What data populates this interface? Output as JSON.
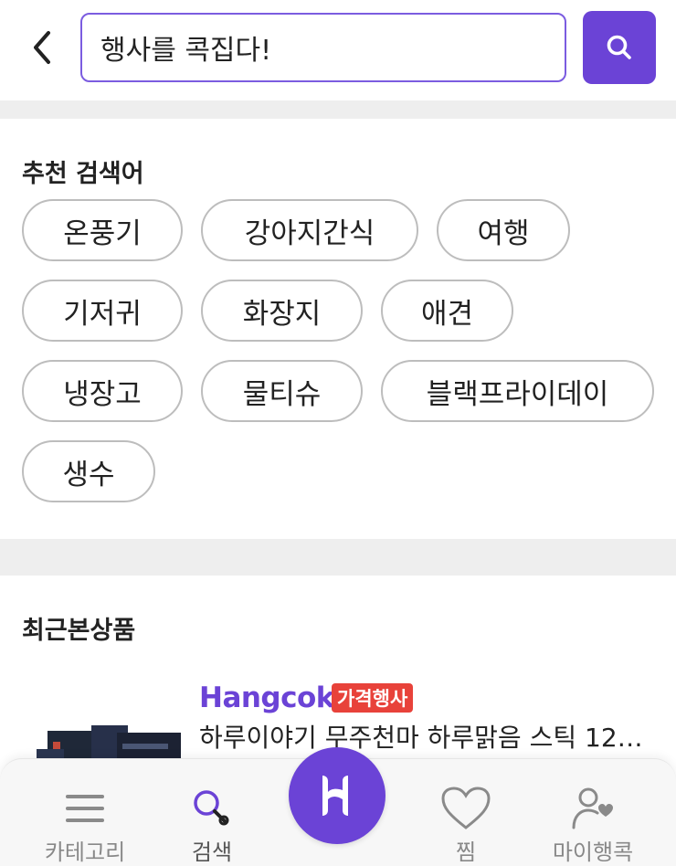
{
  "header": {
    "back_label": "back",
    "search_value": "행사를 콕집다!",
    "search_button": "search"
  },
  "recommended": {
    "title": "추천 검색어",
    "keywords": [
      "온풍기",
      "강아지간식",
      "여행",
      "기저귀",
      "화장지",
      "애견",
      "냉장고",
      "물티슈",
      "블랙프라이데이",
      "생수"
    ]
  },
  "recent": {
    "title": "최근본상품",
    "products": [
      {
        "brand": "Hangcok",
        "badge": "가격행사",
        "name": "하루이야기 무주천마 하루맑음 스틱 12…"
      }
    ]
  },
  "bottom_nav": {
    "items": [
      {
        "label": "카테고리",
        "icon": "menu-icon"
      },
      {
        "label": "검색",
        "icon": "search-icon"
      },
      {
        "label": "",
        "icon": "hangcok-logo-icon"
      },
      {
        "label": "찜",
        "icon": "heart-icon"
      },
      {
        "label": "마이행콕",
        "icon": "user-heart-icon"
      }
    ]
  },
  "colors": {
    "accent": "#6b43d6",
    "badge": "#e8423a",
    "chip_border": "#bdbdbd"
  }
}
